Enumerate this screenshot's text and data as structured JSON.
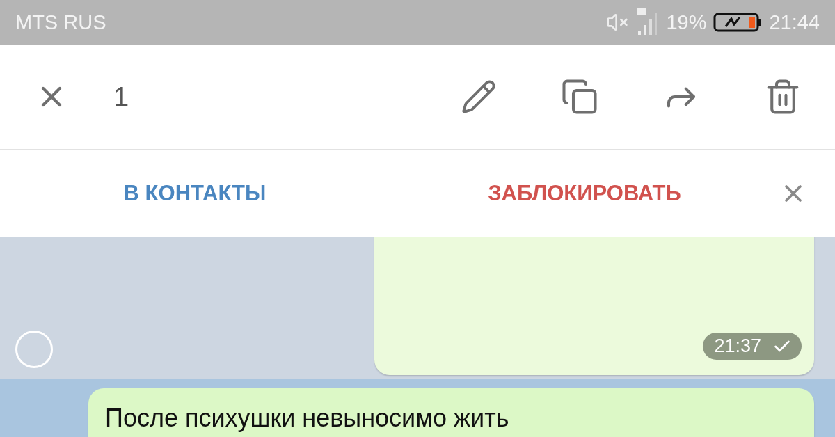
{
  "status_bar": {
    "carrier": "MTS RUS",
    "battery": "19%",
    "time": "21:44"
  },
  "action_bar": {
    "count": "1"
  },
  "contact_bar": {
    "add": "В КОНТАКТЫ",
    "block": "ЗАБЛОКИРОВАТЬ"
  },
  "messages": [
    {
      "time": "21:37",
      "selected": false
    },
    {
      "text": "После психушки невыносимо жить",
      "selected": true
    }
  ]
}
